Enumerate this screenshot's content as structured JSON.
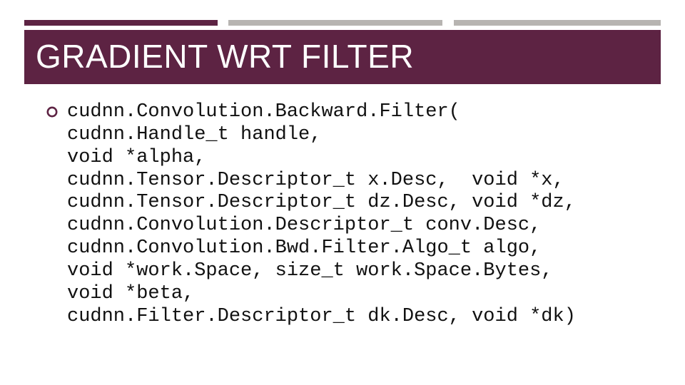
{
  "title": "GRADIENT WRT FILTER",
  "colors": {
    "accent": "#5d2343",
    "muted": "#b7b4b1",
    "text": "#111111",
    "title_text": "#ffffff"
  },
  "bullet": {
    "lines": [
      "cudnn.Convolution.Backward.Filter(",
      "cudnn.Handle_t handle,",
      "void *alpha,",
      "cudnn.Tensor.Descriptor_t x.Desc,  void *x,",
      "cudnn.Tensor.Descriptor_t dz.Desc, void *dz,",
      "cudnn.Convolution.Descriptor_t conv.Desc,",
      "cudnn.Convolution.Bwd.Filter.Algo_t algo,",
      "void *work.Space, size_t work.Space.Bytes,",
      "void *beta,",
      "cudnn.Filter.Descriptor_t dk.Desc, void *dk)"
    ]
  }
}
